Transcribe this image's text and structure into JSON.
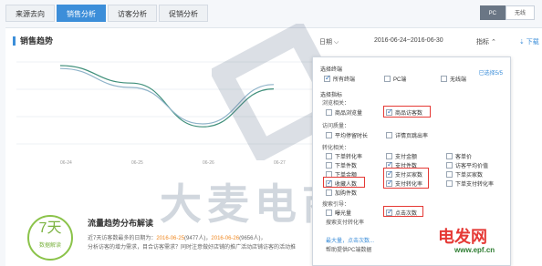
{
  "tabs": [
    {
      "label": "来源去向"
    },
    {
      "label": "销售分析"
    },
    {
      "label": "访客分析"
    },
    {
      "label": "促销分析"
    }
  ],
  "device": {
    "pc": "PC",
    "wireless": "无线"
  },
  "card": {
    "title": "销售趋势",
    "period": "日期 ⌵",
    "daterange": "2016-06-24~2016-06-30",
    "metric": "指标 ⌃",
    "download": "⇣ 下载"
  },
  "chart_data": {
    "type": "line",
    "x": [
      "06-24",
      "06-25",
      "06-26",
      "06-27"
    ],
    "series": [
      {
        "values": [
          60,
          48,
          18,
          44
        ]
      },
      {
        "values": [
          58,
          45,
          20,
          47
        ]
      }
    ],
    "colors": [
      "#3f8f7a",
      "#8fb3c9"
    ]
  },
  "watermark": "大麦电商",
  "bottom": {
    "badge_num": "7天",
    "badge_sub": "数据解读",
    "title": "流量趋势分布解读",
    "line1_a": "近7天访客数最多的日期为：",
    "line1_b": "2016-06-25",
    "line1_c": "(9477人)，",
    "line1_d": "2016-06-26",
    "line1_e": "(9656人)，",
    "line2": "分析访客的增力需求，目合访客需求？同时注意做好店铺的推广活动店铺访客的活动推"
  },
  "dropdown": {
    "select_terminal": "选择终端",
    "selected_count": "已选择5/5",
    "terminals": [
      {
        "label": "所有终端",
        "checked": true
      },
      {
        "label": "PC端",
        "checked": false
      },
      {
        "label": "无线端",
        "checked": false
      }
    ],
    "select_metric": "选择指标",
    "browse_group": "浏览相关：",
    "browse": [
      {
        "label": "商品浏览量",
        "checked": false
      },
      {
        "label": "商品访客数",
        "checked": true
      }
    ],
    "quality_group": "访问质量：",
    "quality": [
      {
        "label": "平均停留时长",
        "checked": false
      },
      {
        "label": "详情页跳出率",
        "checked": false
      }
    ],
    "conversion_group": "转化相关：",
    "conversion_col1": [
      {
        "label": "下单转化率",
        "checked": false
      },
      {
        "label": "下单件数",
        "checked": false
      },
      {
        "label": "下单金额",
        "checked": false
      },
      {
        "label": "收藏人数",
        "checked": true
      },
      {
        "label": "加购件数",
        "checked": false
      }
    ],
    "conversion_col2": [
      {
        "label": "支付金额",
        "checked": false
      },
      {
        "label": "支付件数",
        "checked": true
      },
      {
        "label": "支付买家数",
        "checked": true
      },
      {
        "label": "支付转化率",
        "checked": true
      }
    ],
    "conversion_col3": [
      {
        "label": "客单价",
        "checked": false
      },
      {
        "label": "访客平均价值",
        "checked": false
      },
      {
        "label": "下单买家数",
        "checked": false
      },
      {
        "label": "下单支付转化率",
        "checked": false
      }
    ],
    "search_group": "搜索引导：",
    "search": [
      {
        "label": "曝光量",
        "checked": false
      },
      {
        "label": "点击次数",
        "checked": true
      }
    ],
    "search_desc": "搜索支付转化率",
    "tip": "最大量，点击次数...",
    "tip2": "帮助提供PC端数据"
  },
  "brand": "电发网",
  "site": "www.epf.cn"
}
